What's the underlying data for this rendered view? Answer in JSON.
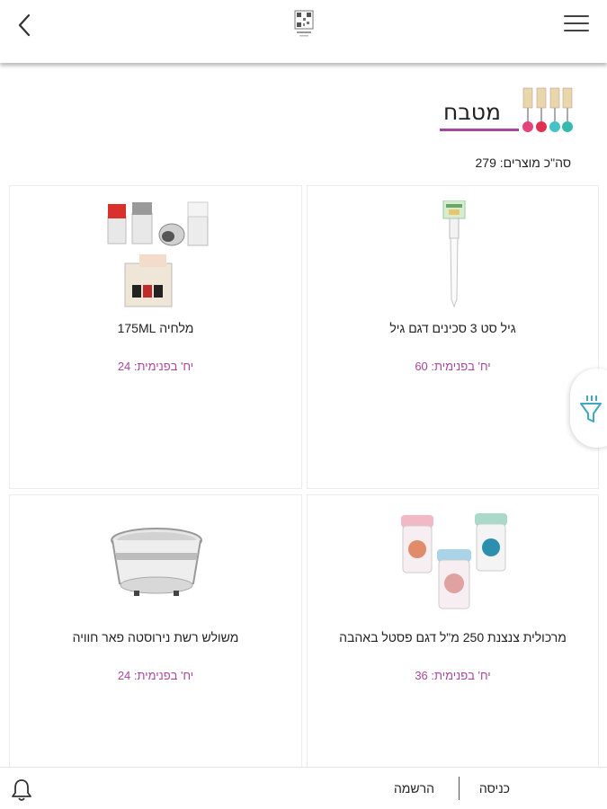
{
  "header": {
    "back_icon": "chevron-left-icon",
    "logo_icon": "qr-logo-icon",
    "menu_icon": "hamburger-menu-icon"
  },
  "category": {
    "title": "מטבח",
    "total_label": "סה\"כ מוצרים: 279",
    "accent_color": "#a7479b"
  },
  "products": [
    {
      "name": "גיל סט 3 סכינים דגם גיל",
      "qty_label": "יח' בפנימית: 60"
    },
    {
      "name": "מלחיה 175ML",
      "qty_label": "יח' בפנימית: 24"
    },
    {
      "name": "מרכולית צנצנת 250 מ\"ל דגם פסטל באהבה",
      "qty_label": "יח' בפנימית: 36"
    },
    {
      "name": "משולש רשת נירוסטה פאר חוויה",
      "qty_label": "יח' בפנימית: 24"
    }
  ],
  "filter": {
    "icon": "filter-funnel-icon"
  },
  "footer": {
    "bell_icon": "bell-icon",
    "login_label": "כניסה",
    "register_label": "הרשמה"
  }
}
